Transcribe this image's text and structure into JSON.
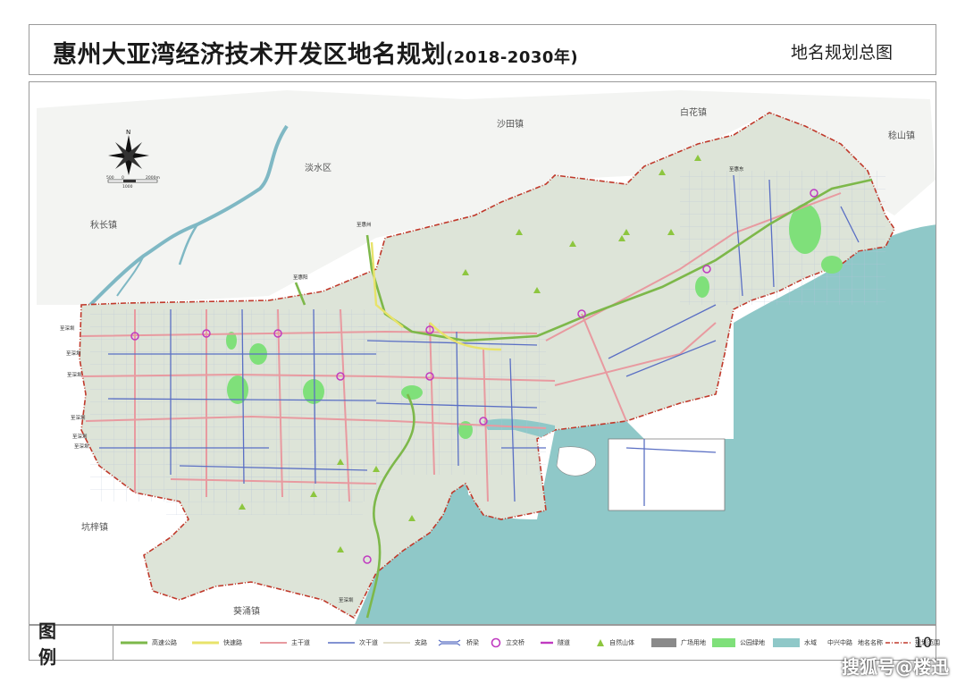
{
  "header": {
    "title": "惠州大亚湾经济技术开发区地名规划",
    "title_years": "(2018-2030年)",
    "subtitle": "地名规划总图"
  },
  "map": {
    "town_labels": {
      "shatian": "沙田镇",
      "baihua": "白花镇",
      "jishan": "稔山镇",
      "danshui": "淡水区",
      "qiuchang": "秋长镇",
      "kengzi": "坑梓镇",
      "kuiyong": "葵涌镇"
    },
    "road_labels": {
      "to_huizhou": "至惠州",
      "to_huiyang": "至惠阳",
      "to_huidong": "至惠东",
      "to_shenzhen_1": "至深圳",
      "to_shenzhen_2": "至深圳",
      "to_shenzhen_3": "至深圳",
      "to_shenzhen_4": "至深圳",
      "to_shenzhen_5": "至深圳",
      "to_shenzhen_6": "至深圳",
      "to_shenzhen_7": "至深圳"
    },
    "compass_label": "N",
    "scale_labels": [
      "500",
      "0",
      "1000",
      "2000m"
    ],
    "colors": {
      "land": "#dde4d8",
      "sea": "#8fc8c8",
      "boundary": "#c0392b",
      "expressway": "#7db84a",
      "fastroad": "#e8e36a",
      "arterial": "#e89aa0",
      "secondary": "#5a6fc4",
      "park": "#7fe07a",
      "river": "#7fb8c4"
    }
  },
  "legend": {
    "title": "图 例",
    "items": [
      {
        "label": "高速公路",
        "icon": "expressway-line"
      },
      {
        "label": "快速路",
        "icon": "fastroad-line"
      },
      {
        "label": "主干道",
        "icon": "arterial-line"
      },
      {
        "label": "次干道",
        "icon": "secondary-line"
      },
      {
        "label": "支路",
        "icon": "branch-line"
      },
      {
        "label": "桥梁",
        "icon": "bridge-symbol"
      },
      {
        "label": "立交桥",
        "icon": "interchange-circle"
      },
      {
        "label": "隧道",
        "icon": "tunnel-symbol"
      },
      {
        "label": "自然山体",
        "icon": "mountain-triangle"
      },
      {
        "label": "广场用地",
        "icon": "plaza-swatch"
      },
      {
        "label": "公园绿地",
        "icon": "park-swatch"
      },
      {
        "label": "水域",
        "icon": "water-swatch"
      },
      {
        "label": "中兴中路",
        "icon": "road-name-text"
      },
      {
        "label": "地名名称",
        "icon": "place-name-text"
      },
      {
        "label": "规划范围",
        "icon": "planning-boundary-line"
      }
    ],
    "page_number": "10"
  },
  "watermark": "搜狐号@楼迅"
}
